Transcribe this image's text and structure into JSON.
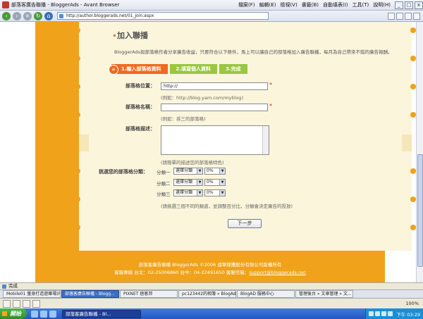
{
  "window": {
    "title": "部落客廣告聯播 - BloggerAds - Avant Browser"
  },
  "menu": [
    "檔案(F)",
    "編輯(E)",
    "檢視(V)",
    "書籤(B)",
    "自動填表(I)",
    "工具(T)",
    "說明(H)"
  ],
  "address": "http://author.bloggerads.net/01_join.aspx",
  "page": {
    "heading": "加入聯播",
    "intro": "BloggerAds與部落格作者分享廣告收益，只要符合以下條件，馬上可以讓自己的部落格加入廣告聯播，每月為自己帶來不錯的廣告報酬。",
    "steps": [
      "1.輸入部落格資料",
      "2.填寫個人資料",
      "3.完成"
    ],
    "form": {
      "url_label": "部落格位置：",
      "url_value": "http://",
      "url_hint": "(例如：http://blog.yam.com/myblog)",
      "name_label": "部落格名稱：",
      "name_hint": "(例如：孫三的部落格)",
      "desc_label": "部落格描述：",
      "desc_hint": "(請簡單的描述您的部落格特色)",
      "cat_label": "挑選您的部落格分類：",
      "cats": [
        {
          "label": "分類一",
          "select": "選擇分類",
          "pct": "0%"
        },
        {
          "label": "分類二",
          "select": "選擇分類",
          "pct": "0%"
        },
        {
          "label": "分類三",
          "select": "選擇分類",
          "pct": "0%"
        }
      ],
      "cat_hint": "(請挑選三個不同的類道，並調整百分比，分類會決定廣告的投放)",
      "next_label": "下一步"
    },
    "footer_line1": "部落客廣告聯播 BloggerAds ©2006 遠擎媒體股份有限公司版權所有",
    "footer_line2": "客服專線 台北：02-25006860 台中：04-22491650 客服信箱：",
    "footer_email": "support@bloggerads.net"
  },
  "status": "完成",
  "tabs": [
    "Mobile01 量身打造遊樂場(P...",
    "部落客廣告聯播 - Blogg...",
    "PIXNET 痞客邦",
    "pc123442的相簿 » BlogAd...",
    "BlogAD 服務中心",
    "管理後台 » 文章管理 » 文..."
  ],
  "zoom": "100%",
  "taskbar": {
    "start": "開始",
    "task": "部落客廣告聯播 - Bl...",
    "clock": "下午 03:29"
  }
}
